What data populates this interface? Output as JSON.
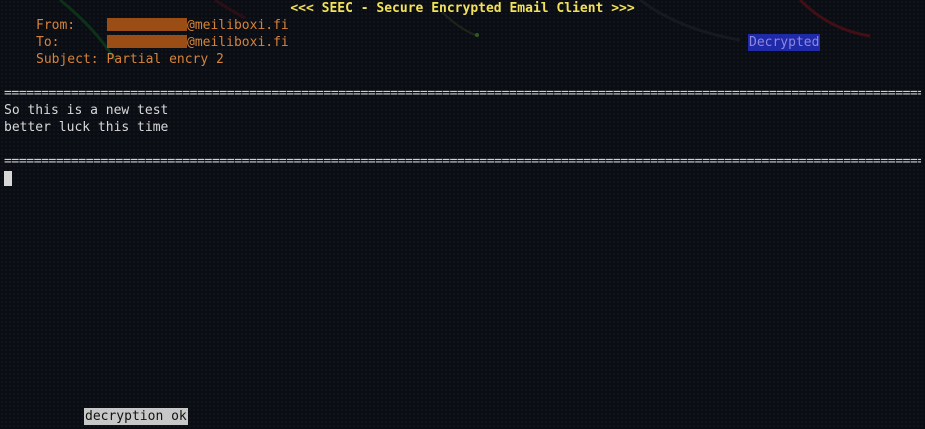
{
  "window": {
    "title": "<<< SEEC - Secure Encrypted Email Client >>>"
  },
  "header": {
    "from_label": "From:",
    "from_domain": "@meiliboxi.fi",
    "to_label": "To:",
    "to_domain": "@meiliboxi.fi",
    "subject_label": "Subject:",
    "subject_value": "Partial encry 2",
    "decrypted_badge": "Decrypted"
  },
  "separator": "============================================================================================================================================",
  "message": {
    "lines": [
      "So this is a new test",
      "better luck this time"
    ]
  },
  "status_bar": {
    "message": "decryption ok"
  },
  "colors": {
    "title": "#f2e15a",
    "header": "#d7833a",
    "badge_bg": "#1f2aa8",
    "status_bg": "#c8c8c8"
  }
}
